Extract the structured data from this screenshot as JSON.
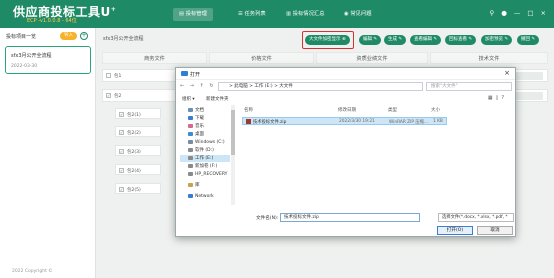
{
  "app": {
    "title": "供应商投标工具U",
    "title_sup": "+",
    "version": "ECP -v1.0.0.8 - 64位"
  },
  "nav": {
    "items": [
      {
        "label": "投标管理",
        "icon": "document-icon",
        "active": true
      },
      {
        "label": "任务列表",
        "icon": "list-icon",
        "active": false
      },
      {
        "label": "投标情况汇总",
        "icon": "chart-icon",
        "active": false
      },
      {
        "label": "常见问题",
        "icon": "help-icon",
        "active": false
      }
    ],
    "right_icons": [
      "pin-icon",
      "user-icon",
      "minimize-icon",
      "maximize-icon",
      "close-icon"
    ]
  },
  "sidebar": {
    "heading": "投标项目一览",
    "import_label": "导入",
    "add_symbol": "+",
    "project": {
      "name": "sfx3月公开全流程",
      "date": "2022-03-30"
    },
    "footer": "2022 Copyright ©"
  },
  "main": {
    "breadcrumb": "sfx3月公开全流程",
    "actions": [
      "大文件加密显示",
      "编辑",
      "生成",
      "查看编辑",
      "回标查看",
      "加密预览",
      "撤回"
    ],
    "columns": [
      "商务文件",
      "价格文件",
      "资质业绩文件",
      "技术文件"
    ],
    "rows": [
      {
        "label": "包1",
        "checked": false
      },
      {
        "label": "包2",
        "checked": true
      }
    ],
    "sub_rows": [
      "包2(1)",
      "包2(2)",
      "包2(3)",
      "包2(4)",
      "包2(5)"
    ]
  },
  "dialog": {
    "title": "打开",
    "close_symbol": "×",
    "nav_arrows": "← → ↑ ↻",
    "path": "> 此电脑 > 工作 (E:) > 大文件",
    "search_placeholder": "搜索\"大文件\"",
    "organize_label": "组织 ▾",
    "new_folder_label": "新建文件夹",
    "tree": [
      {
        "label": "文档",
        "color": "#6b8fb5"
      },
      {
        "label": "下载",
        "color": "#3a7bd5"
      },
      {
        "label": "音乐",
        "color": "#d46a8a"
      },
      {
        "label": "桌面",
        "color": "#3a8ad5"
      },
      {
        "label": "Windows (C:)",
        "color": "#7a8aa0"
      },
      {
        "label": "软件 (D:)",
        "color": "#8a8a8a"
      },
      {
        "label": "工作 (E:)",
        "color": "#8a8a8a",
        "selected": true
      },
      {
        "label": "新加卷 (F:)",
        "color": "#8a8a8a"
      },
      {
        "label": "HP_RECOVERY",
        "color": "#8a8a8a"
      },
      {
        "label": "库",
        "color": "#c9a24a"
      },
      {
        "label": "Network",
        "color": "#3a7bd5"
      }
    ],
    "list_headers": {
      "name": "名称",
      "modified": "修改日期",
      "type": "类型",
      "size": "大小"
    },
    "files": [
      {
        "name": "技术投标文件.zip",
        "modified": "2022/3/30 19:21",
        "type": "WinRAR ZIP 压缩...",
        "size": "1 KB"
      }
    ],
    "filename_label": "文件名(N):",
    "filename_value": "技术投标文件.zip",
    "filetype_value": "选择文件(*.docx, *.xlsx, *.pdf, *",
    "open_label": "打开(O)",
    "cancel_label": "取消"
  }
}
